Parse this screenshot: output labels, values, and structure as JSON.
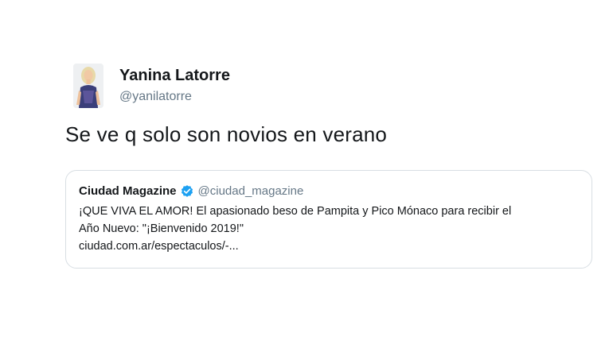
{
  "tweet": {
    "author_name": "Yanina Latorre",
    "author_handle": "@yanilatorre",
    "text": "Se ve q solo son novios en verano"
  },
  "quoted_tweet": {
    "author_name": "Ciudad Magazine",
    "author_handle": "@ciudad_magazine",
    "verified": true,
    "text_line1": "¡QUE VIVA EL AMOR! El apasionado beso de Pampita y Pico Mónaco para recibir el",
    "text_line2": "Año Nuevo: \"¡Bienvenido 2019!\"",
    "link": "ciudad.com.ar/espectaculos/-..."
  },
  "colors": {
    "text": "#14171a",
    "secondary": "#657786",
    "verified_badge": "#1da1f2",
    "border": "#d8dee3"
  },
  "icons": {
    "verified": "verified-badge-icon",
    "avatar": "profile-photo"
  }
}
